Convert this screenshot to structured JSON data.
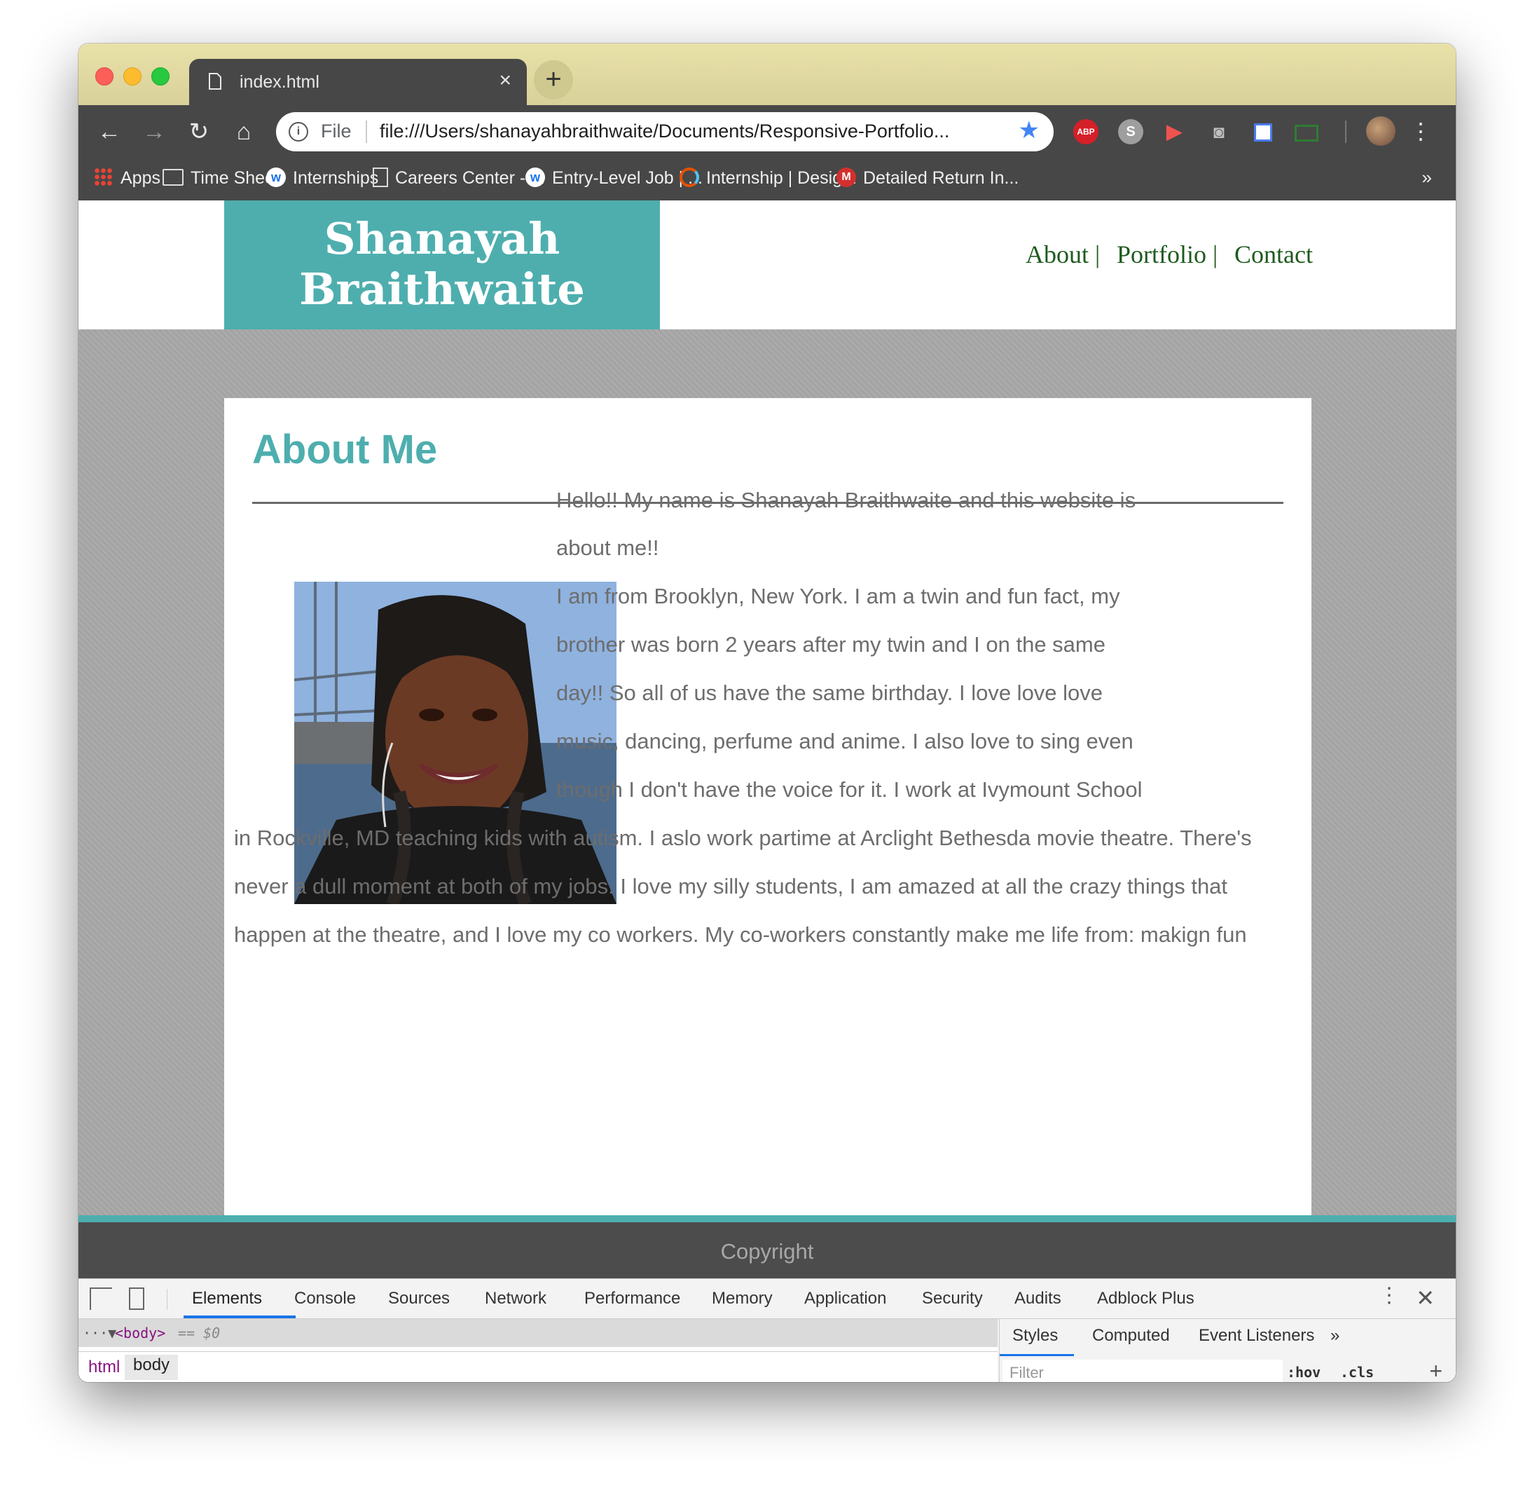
{
  "browser": {
    "tab_title": "index.html",
    "tab_close": "×",
    "new_tab": "+",
    "url_scheme": "File",
    "url": "file:///Users/shanayahbraithwaite/Documents/Responsive-Portfolio...",
    "extensions": {
      "abp": "ABP",
      "s": "S"
    },
    "bookmarks": [
      {
        "label": "Apps",
        "icon": "apps-icon"
      },
      {
        "label": "Time Sheet",
        "icon": "folder-icon"
      },
      {
        "label": "Internships",
        "icon": "w-logo-icon"
      },
      {
        "label": "Careers Center - ...",
        "icon": "document-icon"
      },
      {
        "label": "Entry-Level Job | ...",
        "icon": "w-logo-icon"
      },
      {
        "label": "Internship | Desig...",
        "icon": "ring-logo-icon"
      },
      {
        "label": "Detailed Return In...",
        "icon": "m-logo-icon"
      }
    ],
    "bookmarks_more": "»"
  },
  "site": {
    "logo_line1": "Shanayah",
    "logo_line2": "Braithwaite",
    "nav": {
      "about": "About |",
      "portfolio": "Portfolio |",
      "contact": "Contact"
    },
    "section_title": "About Me",
    "about_lines": [
      "Hello!! My name is Shanayah Braithwaite and this website is",
      "about me!!",
      "I am from Brooklyn, New York. I am a twin and fun fact, my",
      "brother was born 2 years after my twin and I on the same",
      "day!! So all of us have the same birthday. I love love love",
      "music, dancing, perfume and anime. I also love to sing even",
      "though I don't have the voice for it. I work at Ivymount School",
      "in Rockville, MD teaching kids with autism. I aslo work partime at Arclight Bethesda movie theatre. There's",
      "never a dull moment at both of my jobs. I love my silly students, I am amazed at all the crazy things that",
      "happen at the theatre, and I love my co workers. My co-workers constantly make me life from: makign fun"
    ],
    "footer": "Copyright",
    "colors": {
      "accent": "#4eaeae",
      "nav_text": "#1e5a1e",
      "footer_bg": "#4c4c4c",
      "body_text": "#6d6d6d"
    }
  },
  "devtools": {
    "tabs": [
      "Elements",
      "Console",
      "Sources",
      "Network",
      "Performance",
      "Memory",
      "Application",
      "Security",
      "Audits",
      "Adblock Plus"
    ],
    "dom_prefix": "···▼",
    "dom_tag": "<body>",
    "dom_suffix": "== $0",
    "breadcrumbs": [
      "html",
      "body"
    ],
    "sidebar_tabs": [
      "Styles",
      "Computed",
      "Event Listeners",
      "»"
    ],
    "filter_placeholder": "Filter",
    "hov": ":hov",
    "cls": ".cls",
    "add": "+"
  }
}
